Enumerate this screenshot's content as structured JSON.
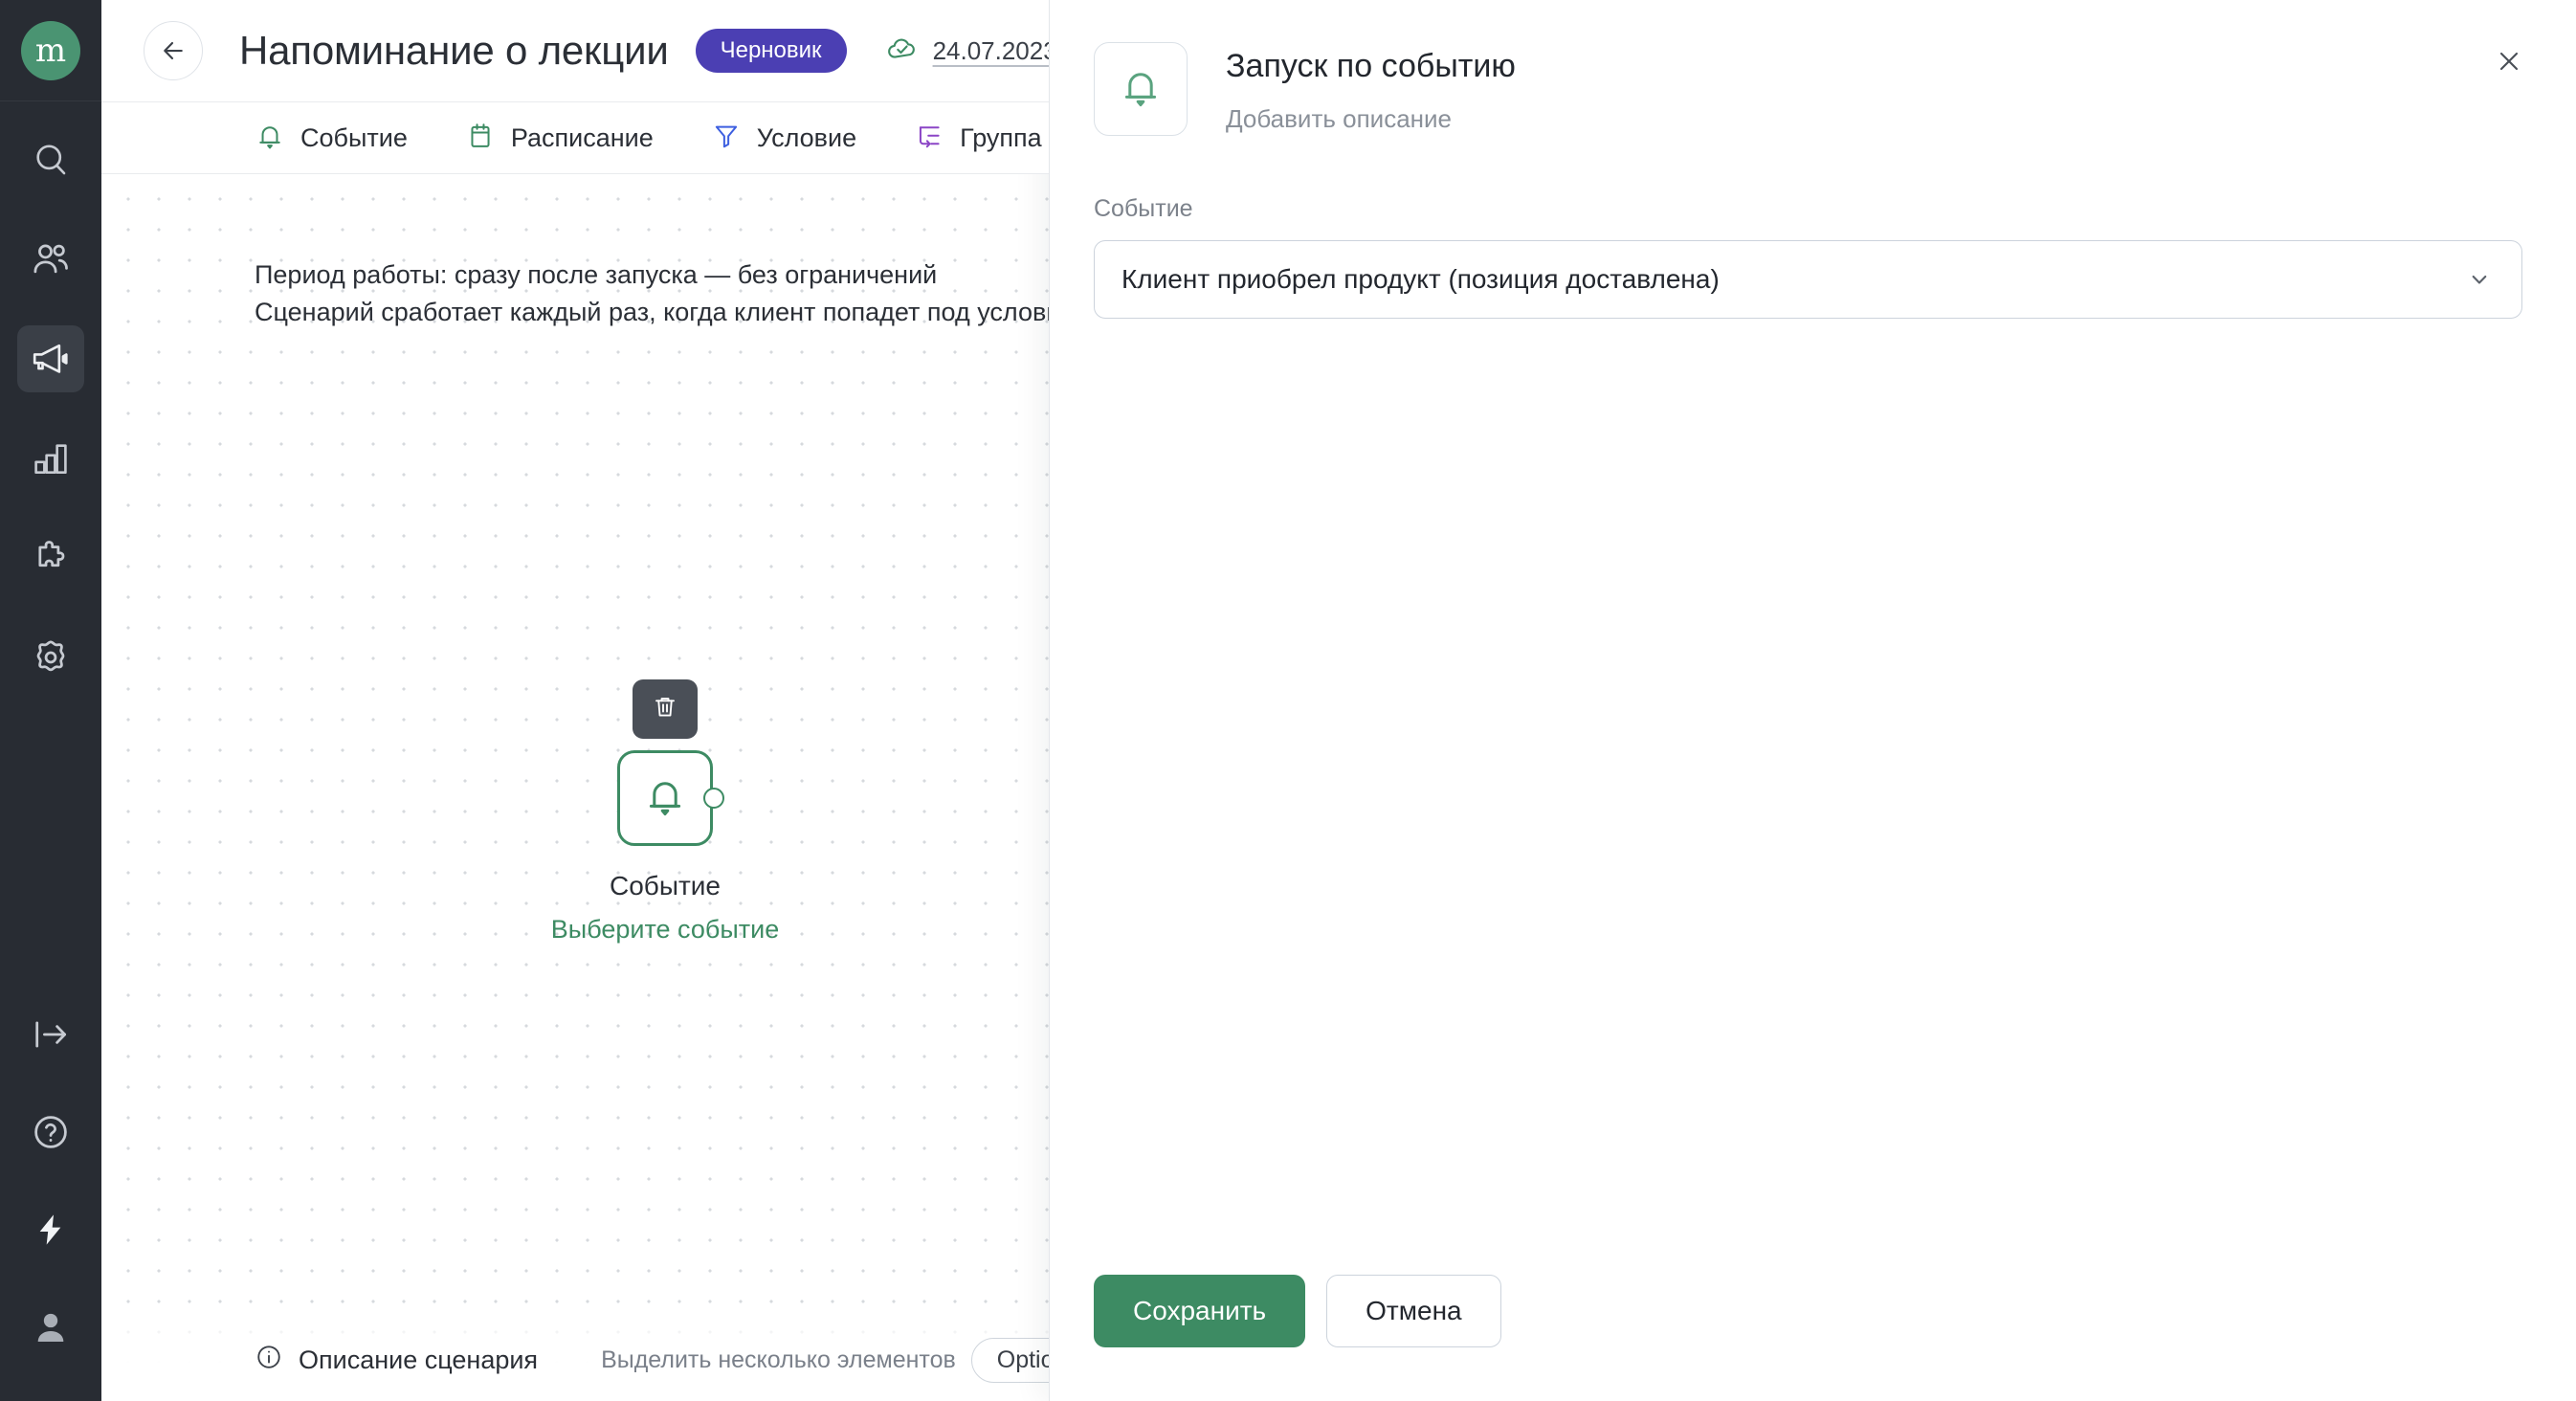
{
  "brand": {
    "logo_text": "m",
    "accent_green": "#3d8b63",
    "rail_bg": "#282c33"
  },
  "rail": {
    "top_items": [
      {
        "name": "search-icon",
        "label": "Поиск",
        "active": false
      },
      {
        "name": "contacts-icon",
        "label": "Контакты",
        "active": false
      },
      {
        "name": "campaigns-icon",
        "label": "Рассылки",
        "active": true
      },
      {
        "name": "analytics-icon",
        "label": "Аналитика",
        "active": false
      },
      {
        "name": "integrations-icon",
        "label": "Интеграции",
        "active": false
      },
      {
        "name": "settings-icon",
        "label": "Настройки",
        "active": false
      }
    ],
    "bottom_items": [
      {
        "name": "collapse-icon",
        "label": "Свернуть"
      },
      {
        "name": "help-icon",
        "label": "Помощь"
      },
      {
        "name": "lightning-icon",
        "label": "Быстрые действия"
      },
      {
        "name": "account-icon",
        "label": "Профиль"
      }
    ]
  },
  "header": {
    "back_label": "Назад",
    "title": "Напоминание о лекции",
    "status_badge": "Черновик",
    "saved_date": "24.07.2023",
    "save_icon_color": "#3d8b63"
  },
  "tabs": [
    {
      "label": "Событие",
      "icon": "bell-icon",
      "color": "#3d8b63"
    },
    {
      "label": "Расписание",
      "icon": "calendar-icon",
      "color": "#3d8b63"
    },
    {
      "label": "Условие",
      "icon": "filter-icon",
      "color": "#3d5fe0"
    },
    {
      "label": "Группа",
      "icon": "group-icon",
      "color": "#8b45c6"
    }
  ],
  "canvas": {
    "note_line_1": "Период работы: сразу после запуска — без ограничений",
    "note_line_2": "Сценарий сработает каждый раз, когда клиент попадет под условия",
    "node": {
      "delete_tooltip": "Удалить",
      "title": "Событие",
      "subtitle": "Выберите событие",
      "icon": "bell-icon"
    },
    "footer": {
      "description_link": "Описание сценария",
      "hint_text": "Выделить несколько элементов",
      "key_cap": "Option",
      "key_plus": "+"
    }
  },
  "panel": {
    "icon": "bell-icon",
    "title": "Запуск по событию",
    "description_placeholder": "Добавить описание",
    "close_label": "Закрыть",
    "field": {
      "label": "Событие",
      "value": "Клиент приобрел продукт (позиция доставлена)"
    },
    "buttons": {
      "save": "Сохранить",
      "cancel": "Отмена"
    }
  }
}
